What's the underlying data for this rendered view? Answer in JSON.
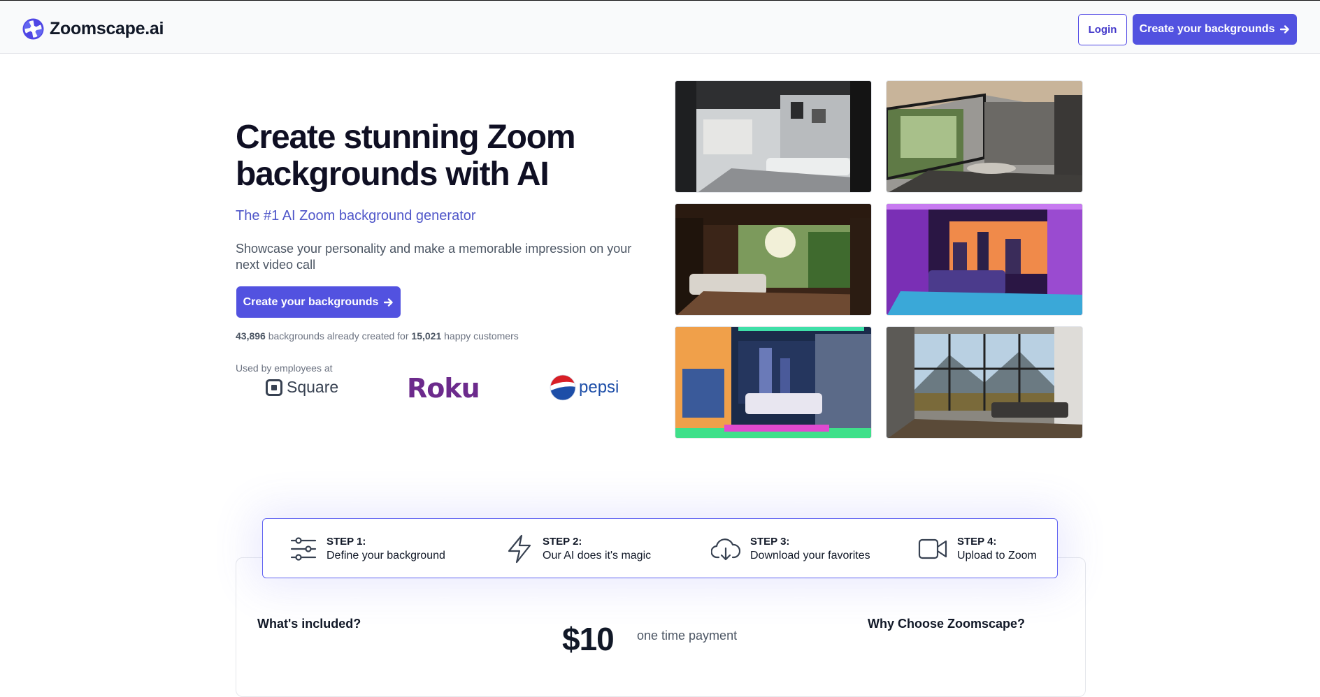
{
  "header": {
    "brand": "Zoomscape.ai",
    "login_label": "Login",
    "cta_label": "Create your backgrounds"
  },
  "hero": {
    "title_line1": "Create stunning Zoom",
    "title_line2": "backgrounds with AI",
    "subtitle": "The #1 AI Zoom background generator",
    "description": "Showcase your personality and make a memorable impression on your next video call",
    "cta_label": "Create your backgrounds",
    "stats": {
      "backgrounds_count": "43,896",
      "backgrounds_text": " backgrounds already created for ",
      "customers_count": "15,021",
      "customers_text": " happy customers"
    },
    "used_by_label": "Used by employees at",
    "logos": [
      {
        "name": "Square",
        "text": "Square"
      },
      {
        "name": "Roku",
        "text": "Roku"
      },
      {
        "name": "Pepsi",
        "text": "pepsi"
      }
    ]
  },
  "gallery": [
    {
      "name": "modern-grey-living-room"
    },
    {
      "name": "forest-view-living-room"
    },
    {
      "name": "jungle-view-lounge"
    },
    {
      "name": "neon-purple-bedroom-city"
    },
    {
      "name": "neon-rainbow-bedroom-city"
    },
    {
      "name": "mountain-view-loft"
    }
  ],
  "steps": [
    {
      "icon": "sliders-icon",
      "title": "STEP 1:",
      "desc": "Define your background"
    },
    {
      "icon": "lightning-icon",
      "title": "STEP 2:",
      "desc": "Our AI does it's magic"
    },
    {
      "icon": "cloud-download-icon",
      "title": "STEP 3:",
      "desc": "Download your favorites"
    },
    {
      "icon": "video-camera-icon",
      "title": "STEP 4:",
      "desc": "Upload to Zoom"
    }
  ],
  "pricing": {
    "included_heading": "What's included?",
    "price": "$10",
    "price_note": "one time payment",
    "why_heading": "Why Choose Zoomscape?"
  },
  "colors": {
    "accent": "#5252e0",
    "accent_text": "#4f56c9",
    "brand_icon": "#4f46e5",
    "roku": "#6c2a8c",
    "pepsi": "#1d4ea8"
  }
}
